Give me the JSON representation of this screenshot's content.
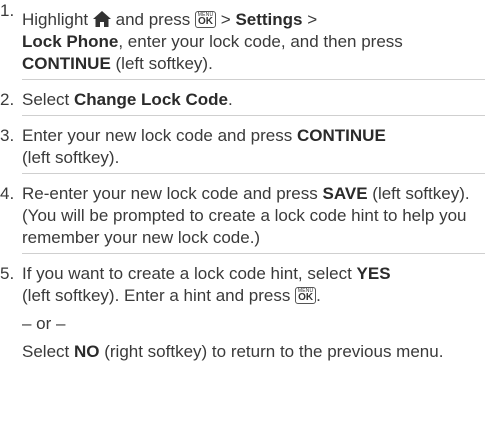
{
  "steps": [
    {
      "number": "1.",
      "t1": "Highlight",
      "home_icon": "home-icon",
      "t2": "and press",
      "menu_key_top": "MENU",
      "menu_key_bottom": "OK",
      "t3": ">",
      "b1": "Settings",
      "t4": ">",
      "b2": "Lock Phone",
      "t5": ", enter your lock code, and then press",
      "b3": "CONTINUE",
      "t6": "(left softkey)."
    },
    {
      "number": "2.",
      "t1": "Select",
      "b1": "Change Lock Code",
      "t2": "."
    },
    {
      "number": "3.",
      "t1": "Enter your new lock code and press",
      "b1": "CONTINUE",
      "t2": "(left softkey)."
    },
    {
      "number": "4.",
      "t1": "Re-enter your new lock code and press",
      "b1": "SAVE",
      "t2": "(left softkey). (You will be prompted to create a lock code hint to help you remember your new lock code.)"
    },
    {
      "number": "5.",
      "t1": "If you want to create a lock code hint, select",
      "b1": "YES",
      "t2": "(left softkey). Enter a hint and press",
      "menu_key_top": "MENU",
      "menu_key_bottom": "OK",
      "t3": ".",
      "or_text": "– or –",
      "t4": "Select",
      "b2": "NO",
      "t5": "(right softkey) to return to the previous menu."
    }
  ],
  "colors": {
    "text": "#3a3a3a",
    "separator": "#cfcfcf"
  }
}
